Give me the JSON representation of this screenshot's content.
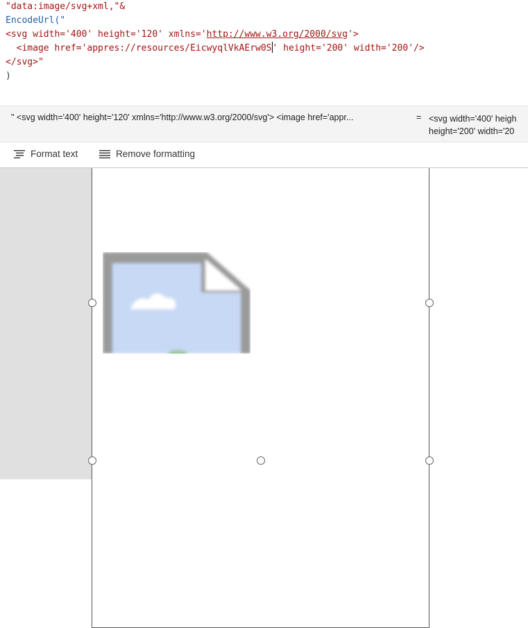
{
  "editor": {
    "code_lines": [
      "\"data:image/svg+xml,\"&",
      "EncodeUrl(\"",
      "<svg width='400' height='120' xmlns='",
      "http://www.w3.org/2000/svg",
      "'>",
      "  <image href='appres://resources/EicwyqlVkAErw0S",
      "' height='200' width='200'/>",
      "</svg>\"",
      ")"
    ]
  },
  "result": {
    "expression": "\" <svg width='400' height='120' xmlns='http://www.w3.org/2000/svg'> <image href='appr...",
    "equals": "=",
    "value_line1": "<svg width='400' heigh",
    "value_line2": "height='200' width='20"
  },
  "toolbar": {
    "format_text_label": "Format text",
    "remove_formatting_label": "Remove formatting"
  }
}
